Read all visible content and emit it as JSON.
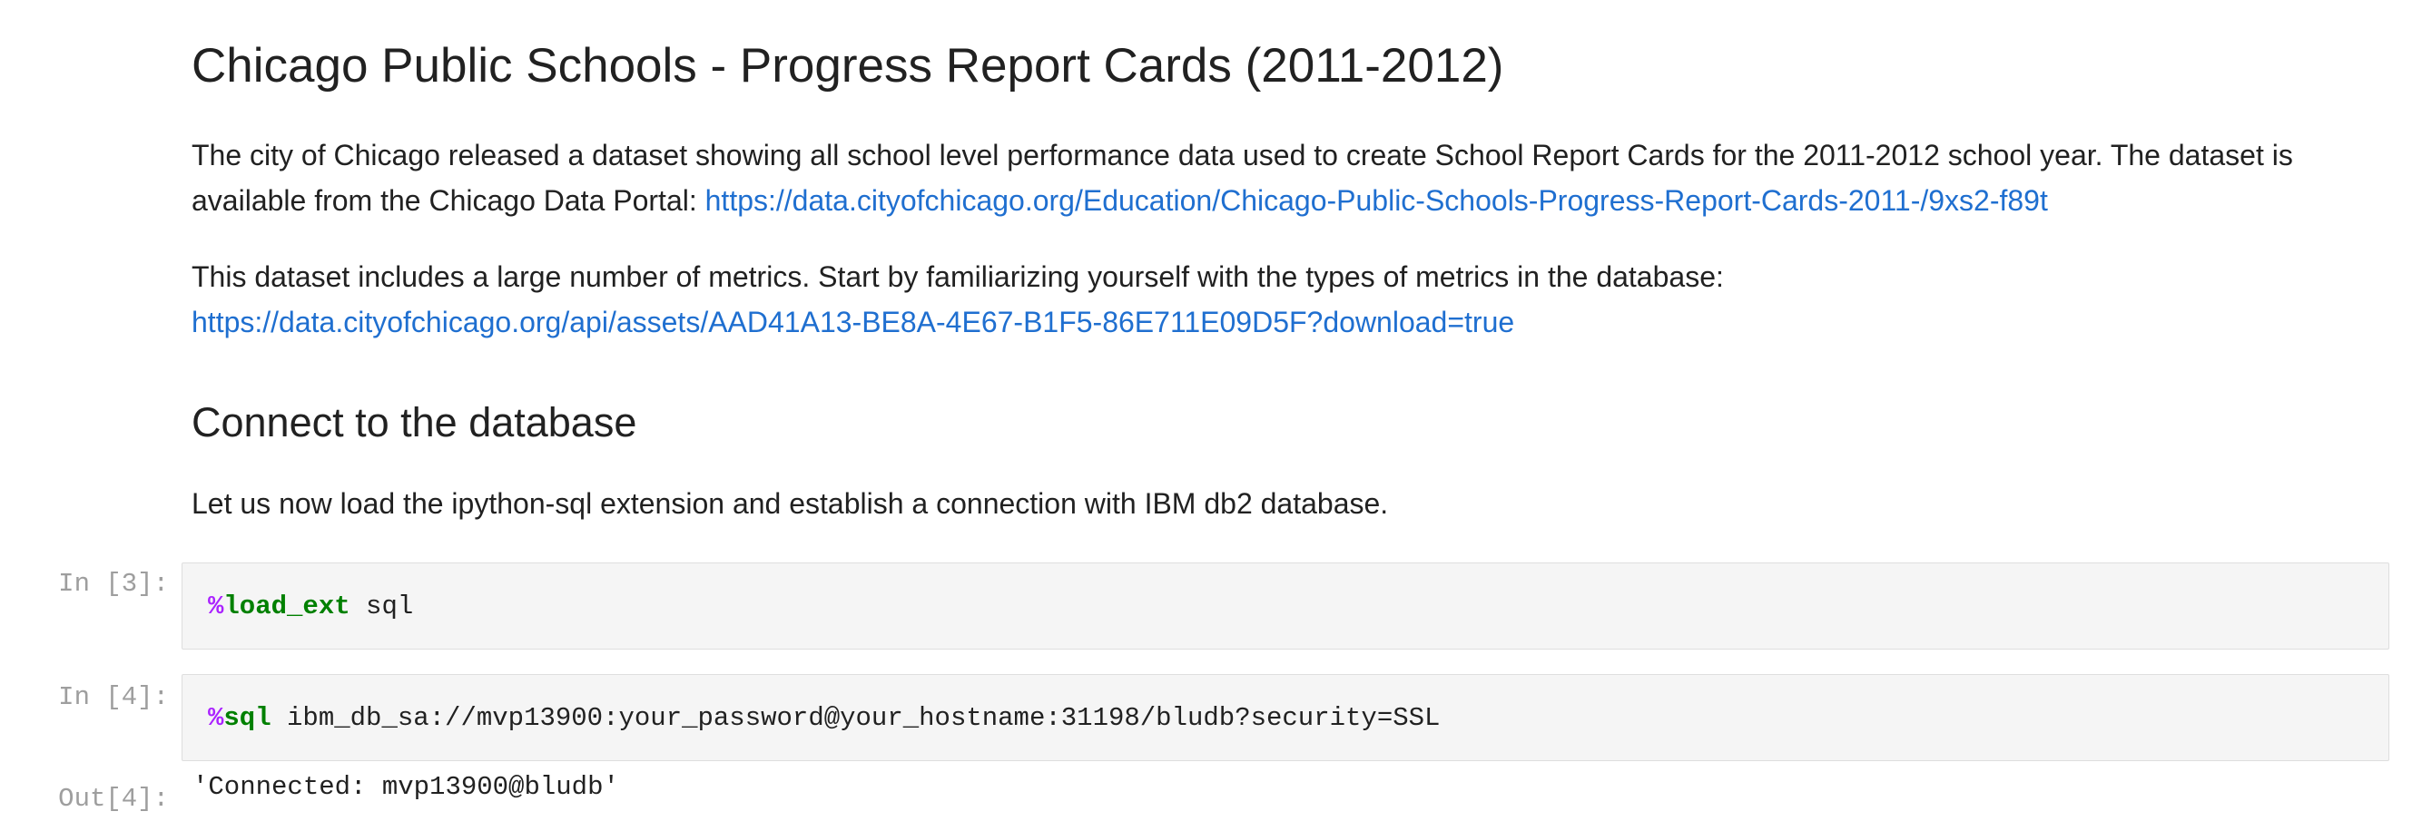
{
  "markdown": {
    "title": "Chicago Public Schools - Progress Report Cards (2011-2012)",
    "para1_text": "The city of Chicago released a dataset showing all school level performance data used to create School Report Cards for the 2011-2012 school year. The dataset is available from the Chicago Data Portal: ",
    "para1_link": "https://data.cityofchicago.org/Education/Chicago-Public-Schools-Progress-Report-Cards-2011-/9xs2-f89t",
    "para2_text": "This dataset includes a large number of metrics. Start by familiarizing yourself with the types of metrics in the database:",
    "para2_link": "https://data.cityofchicago.org/api/assets/AAD41A13-BE8A-4E67-B1F5-86E711E09D5F?download=true",
    "section_heading": "Connect to the database",
    "para3_text": "Let us now load the ipython-sql extension and establish a connection with IBM db2 database."
  },
  "cells": [
    {
      "prompt": "In [3]:",
      "magic_pct": "%",
      "magic_name": "load_ext",
      "code_rest": " sql"
    },
    {
      "prompt": "In [4]:",
      "magic_pct": "%",
      "magic_name": "sql",
      "code_rest": " ibm_db_sa://mvp13900:your_password@your_hostname:31198/bludb?security=SSL",
      "out_prompt": "Out[4]:",
      "output": "'Connected: mvp13900@bludb'"
    }
  ],
  "colors": {
    "link": "#1f6fd0",
    "magic_pct": "#aa22ff",
    "magic_name": "#008000",
    "prompt": "#9e9e9e",
    "cell_background": "#f5f5f5"
  }
}
